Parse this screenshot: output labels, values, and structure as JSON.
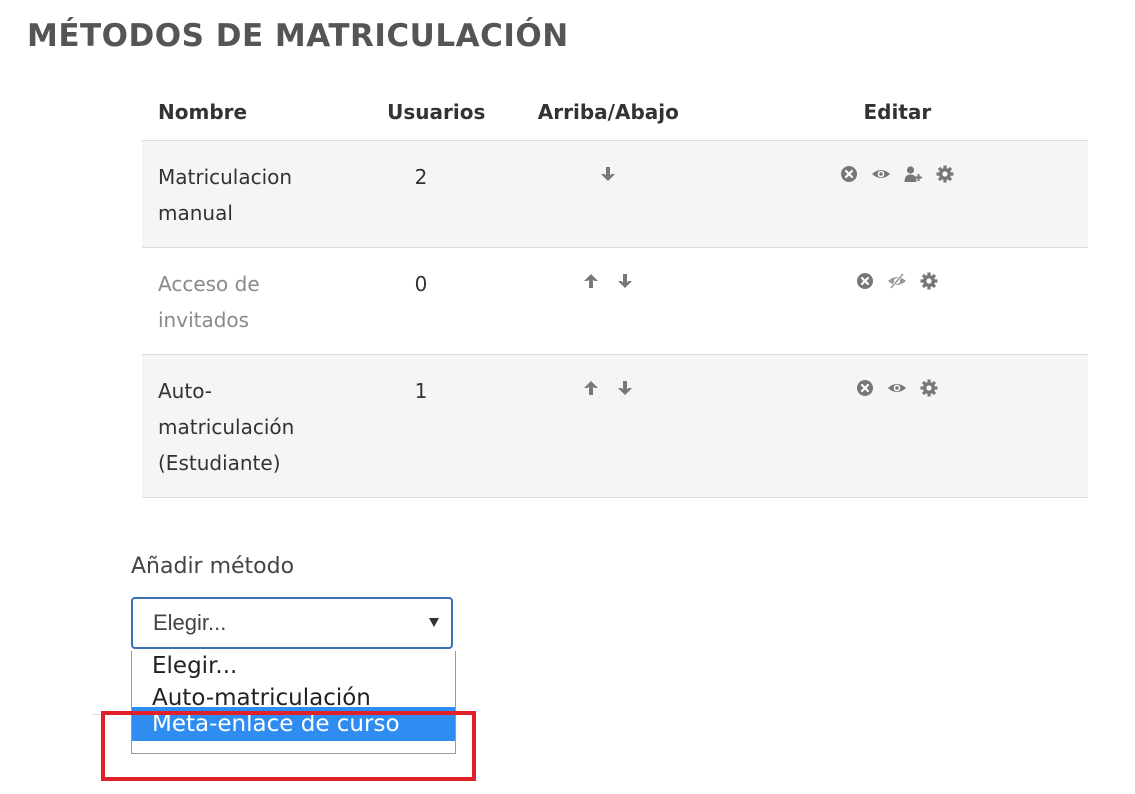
{
  "page": {
    "title": "MÉTODOS DE MATRICULACIÓN"
  },
  "table": {
    "headers": {
      "name": "Nombre",
      "users": "Usuarios",
      "move": "Arriba/Abajo",
      "edit": "Editar"
    },
    "rows": [
      {
        "name_line1": "Matriculacion",
        "name_line2": "manual",
        "name_line3": "",
        "users": "2",
        "dimmed": false,
        "move_icons": [
          "arrow-down-icon"
        ],
        "edit_icons": [
          "delete-icon",
          "eye-icon",
          "enrol-users-icon",
          "settings-gear-icon"
        ]
      },
      {
        "name_line1": "Acceso de",
        "name_line2": "invitados",
        "name_line3": "",
        "users": "0",
        "dimmed": true,
        "move_icons": [
          "arrow-up-icon",
          "arrow-down-icon"
        ],
        "edit_icons": [
          "delete-icon",
          "eye-slash-icon",
          "settings-gear-icon"
        ]
      },
      {
        "name_line1": "Auto-",
        "name_line2": "matriculación",
        "name_line3": "(Estudiante)",
        "users": "1",
        "dimmed": false,
        "move_icons": [
          "arrow-up-icon",
          "arrow-down-icon"
        ],
        "edit_icons": [
          "delete-icon",
          "eye-icon",
          "settings-gear-icon"
        ]
      }
    ]
  },
  "add_method": {
    "label": "Añadir método",
    "selected_value": "Elegir...",
    "options": [
      "Elegir...",
      "Auto-matriculación",
      "Meta-enlace de curso"
    ],
    "highlighted_option": "Meta-enlace de curso"
  },
  "colors": {
    "icon_gray": "#777777",
    "highlight_red": "#e0202a",
    "selection_blue": "#2f8cf0",
    "focus_border": "#3b6fb6"
  }
}
